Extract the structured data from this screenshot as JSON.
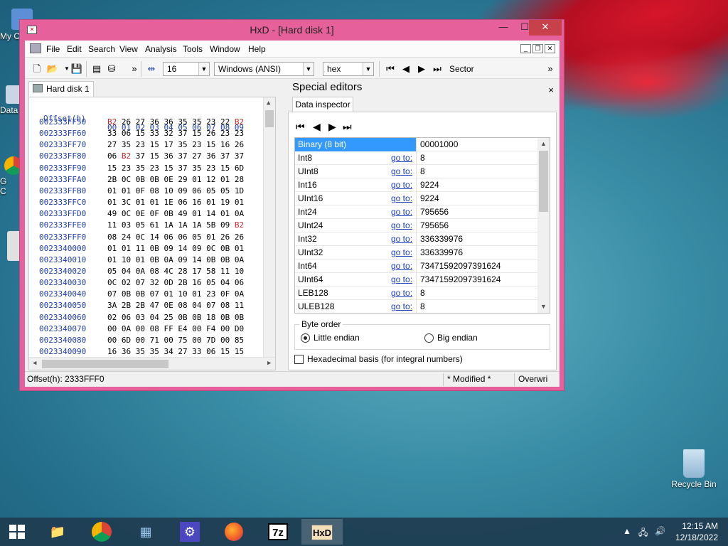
{
  "desktop": {
    "icons": [
      {
        "label": "My C",
        "id": "my-computer"
      },
      {
        "label": "Data",
        "id": "data"
      },
      {
        "label": "G\nC",
        "id": "chrome-shortcut"
      },
      {
        "label": "Recycle Bin",
        "id": "recycle-bin"
      }
    ]
  },
  "window": {
    "title": "HxD - [Hard disk 1]",
    "controls": {
      "minimize": "—",
      "maximize": "☐",
      "close": "✕"
    }
  },
  "menubar": {
    "items": [
      "File",
      "Edit",
      "Search",
      "View",
      "Analysis",
      "Tools",
      "Window",
      "Help"
    ],
    "mdi": {
      "minimize": "_",
      "restore": "❐",
      "close": "✕"
    }
  },
  "toolbar": {
    "bytes_per_row": "16",
    "charset": "Windows (ANSI)",
    "offset_base": "hex",
    "sector_label": "Sector",
    "more": "»"
  },
  "hex_editor": {
    "tab_label": "Hard disk 1",
    "header_offset": "Offset(h)",
    "header_bytes": "00 01 02 03 04 05 06 07 08 09",
    "rows": [
      {
        "offset": "002333FF50",
        "bytes": [
          "B2",
          "26",
          "27",
          "36",
          "36",
          "35",
          "35",
          "23",
          "22",
          "B2"
        ],
        "red": [
          0,
          9
        ]
      },
      {
        "offset": "002333FF60",
        "bytes": [
          "33",
          "06",
          "15",
          "33",
          "32",
          "37",
          "15",
          "26",
          "23",
          "23"
        ],
        "red": []
      },
      {
        "offset": "002333FF70",
        "bytes": [
          "27",
          "35",
          "23",
          "15",
          "17",
          "35",
          "23",
          "15",
          "16",
          "26"
        ],
        "red": []
      },
      {
        "offset": "002333FF80",
        "bytes": [
          "06",
          "B2",
          "37",
          "15",
          "36",
          "37",
          "27",
          "36",
          "37",
          "37"
        ],
        "red": [
          1
        ]
      },
      {
        "offset": "002333FF90",
        "bytes": [
          "15",
          "23",
          "35",
          "23",
          "15",
          "37",
          "35",
          "23",
          "15",
          "6D"
        ],
        "red": []
      },
      {
        "offset": "002333FFA0",
        "bytes": [
          "2B",
          "0C",
          "0B",
          "0B",
          "0E",
          "29",
          "01",
          "12",
          "01",
          "28"
        ],
        "red": []
      },
      {
        "offset": "002333FFB0",
        "bytes": [
          "01",
          "01",
          "0F",
          "08",
          "10",
          "09",
          "06",
          "05",
          "05",
          "1D"
        ],
        "red": []
      },
      {
        "offset": "002333FFC0",
        "bytes": [
          "01",
          "3C",
          "01",
          "01",
          "1E",
          "06",
          "16",
          "01",
          "19",
          "01"
        ],
        "red": []
      },
      {
        "offset": "002333FFD0",
        "bytes": [
          "49",
          "0C",
          "0E",
          "0F",
          "0B",
          "49",
          "01",
          "14",
          "01",
          "0A"
        ],
        "red": []
      },
      {
        "offset": "002333FFE0",
        "bytes": [
          "11",
          "03",
          "05",
          "61",
          "1A",
          "1A",
          "1A",
          "5B",
          "09",
          "B2"
        ],
        "red": [
          9
        ]
      },
      {
        "offset": "002333FFF0",
        "bytes": [
          "08",
          "24",
          "0C",
          "14",
          "06",
          "06",
          "05",
          "01",
          "26",
          "26"
        ],
        "red": []
      },
      {
        "offset": "0023340000",
        "bytes": [
          "01",
          "01",
          "11",
          "0B",
          "09",
          "14",
          "09",
          "0C",
          "0B",
          "01"
        ],
        "red": []
      },
      {
        "offset": "0023340010",
        "bytes": [
          "01",
          "10",
          "01",
          "0B",
          "0A",
          "09",
          "14",
          "0B",
          "0B",
          "0A"
        ],
        "red": []
      },
      {
        "offset": "0023340020",
        "bytes": [
          "05",
          "04",
          "0A",
          "08",
          "4C",
          "28",
          "17",
          "58",
          "11",
          "10"
        ],
        "red": []
      },
      {
        "offset": "0023340030",
        "bytes": [
          "0C",
          "02",
          "07",
          "32",
          "0D",
          "2B",
          "16",
          "05",
          "04",
          "06"
        ],
        "red": []
      },
      {
        "offset": "0023340040",
        "bytes": [
          "07",
          "0B",
          "0B",
          "07",
          "01",
          "10",
          "01",
          "23",
          "0F",
          "0A"
        ],
        "red": []
      },
      {
        "offset": "0023340050",
        "bytes": [
          "3A",
          "2B",
          "2B",
          "47",
          "0E",
          "08",
          "04",
          "07",
          "08",
          "11"
        ],
        "red": []
      },
      {
        "offset": "0023340060",
        "bytes": [
          "02",
          "06",
          "03",
          "04",
          "25",
          "0B",
          "0B",
          "18",
          "0B",
          "0B"
        ],
        "red": []
      },
      {
        "offset": "0023340070",
        "bytes": [
          "00",
          "0A",
          "00",
          "08",
          "FF",
          "E4",
          "00",
          "F4",
          "00",
          "D0"
        ],
        "red": []
      },
      {
        "offset": "0023340080",
        "bytes": [
          "00",
          "6D",
          "00",
          "71",
          "00",
          "75",
          "00",
          "7D",
          "00",
          "85"
        ],
        "red": []
      },
      {
        "offset": "0023340090",
        "bytes": [
          "16",
          "36",
          "35",
          "35",
          "34",
          "27",
          "33",
          "06",
          "15",
          "15"
        ],
        "red": []
      }
    ]
  },
  "special_editors": {
    "title": "Special editors",
    "close": "×",
    "tab": "Data inspector",
    "rows": [
      {
        "name": "Binary (8 bit)",
        "goto": "",
        "value": "00001000",
        "selected": true
      },
      {
        "name": "Int8",
        "goto": "go to:",
        "value": "8"
      },
      {
        "name": "UInt8",
        "goto": "go to:",
        "value": "8"
      },
      {
        "name": "Int16",
        "goto": "go to:",
        "value": "9224"
      },
      {
        "name": "UInt16",
        "goto": "go to:",
        "value": "9224"
      },
      {
        "name": "Int24",
        "goto": "go to:",
        "value": "795656"
      },
      {
        "name": "UInt24",
        "goto": "go to:",
        "value": "795656"
      },
      {
        "name": "Int32",
        "goto": "go to:",
        "value": "336339976"
      },
      {
        "name": "UInt32",
        "goto": "go to:",
        "value": "336339976"
      },
      {
        "name": "Int64",
        "goto": "go to:",
        "value": "73471592097391624"
      },
      {
        "name": "UInt64",
        "goto": "go to:",
        "value": "73471592097391624"
      },
      {
        "name": "LEB128",
        "goto": "go to:",
        "value": "8"
      },
      {
        "name": "ULEB128",
        "goto": "go to:",
        "value": "8"
      }
    ],
    "byte_order": {
      "legend": "Byte order",
      "little": "Little endian",
      "big": "Big endian",
      "selected": "little"
    },
    "hex_basis_label": "Hexadecimal basis (for integral numbers)"
  },
  "statusbar": {
    "offset": "Offset(h): 2333FFF0",
    "modified": "* Modified *",
    "mode": "Overwri"
  },
  "taskbar": {
    "time": "12:15 AM",
    "date": "12/18/2022",
    "items": [
      "start-button",
      "file-explorer",
      "chrome",
      "control-panel",
      "settings",
      "firefox",
      "7-zip",
      "hxd"
    ]
  }
}
